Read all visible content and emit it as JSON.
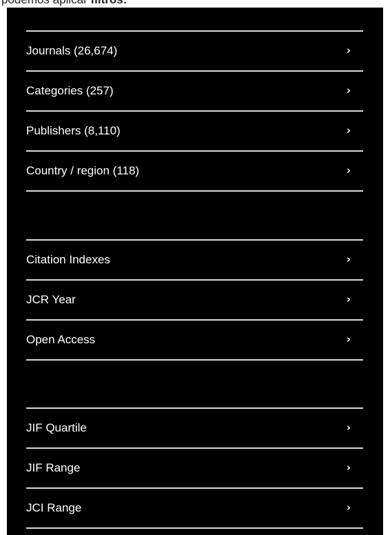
{
  "caption": {
    "prefix": "podemos aplicar ",
    "emphasis": "filtros:"
  },
  "filters": {
    "group1": [
      {
        "label": "Journals (26,674)"
      },
      {
        "label": "Categories (257)"
      },
      {
        "label": "Publishers (8,110)"
      },
      {
        "label": "Country / region (118)"
      }
    ],
    "group2": [
      {
        "label": "Citation Indexes"
      },
      {
        "label": "JCR Year"
      },
      {
        "label": "Open Access"
      }
    ],
    "group3": [
      {
        "label": "JIF Quartile"
      },
      {
        "label": "JIF Range"
      },
      {
        "label": "JCI Range"
      }
    ]
  },
  "icons": {
    "chevron": "chevron-right-icon",
    "chevron_glyph": "›"
  },
  "colors": {
    "panel_background": "#000000",
    "text": "#ffffff",
    "divider": "#d9d9d9"
  }
}
